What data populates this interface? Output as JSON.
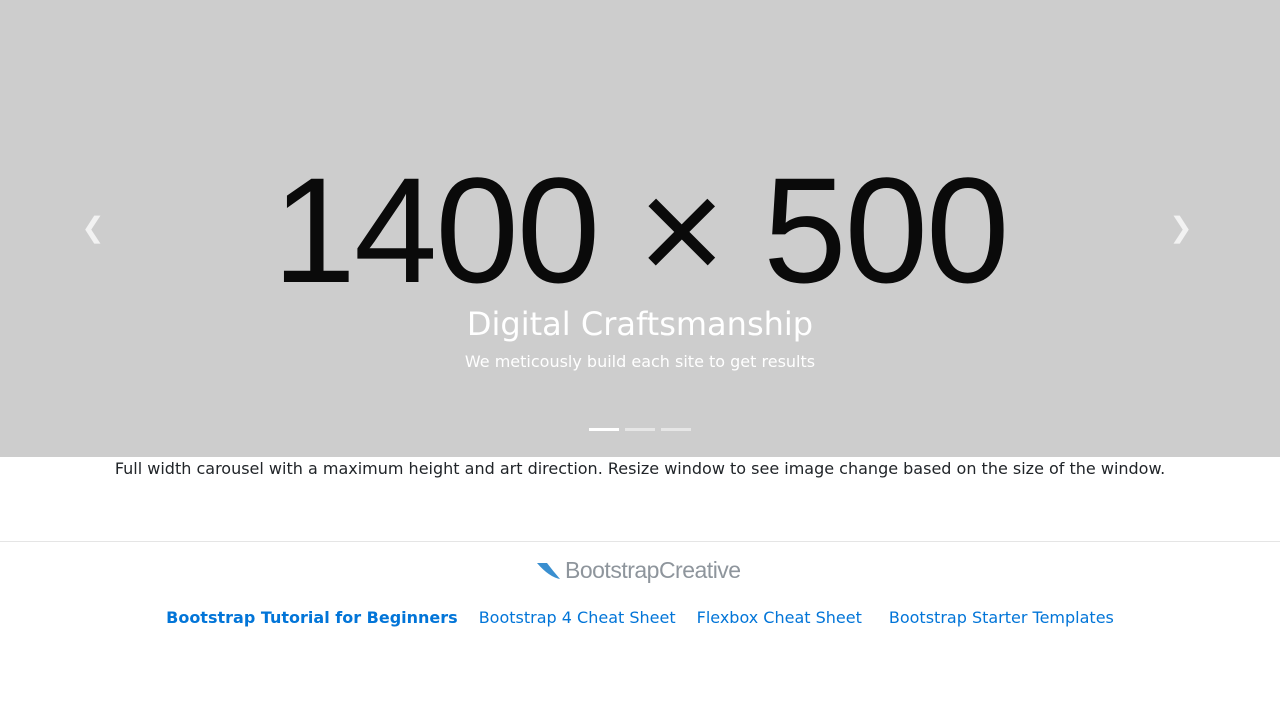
{
  "carousel": {
    "image_text": "1400 × 500",
    "caption_title": "Digital Craftsmanship",
    "caption_text": "We meticously build each site to get results",
    "prev_icon": "chevron-left-icon",
    "next_icon": "chevron-right-icon",
    "indicators": 3,
    "active_index": 0
  },
  "description": "Full width carousel with a maximum height and art direction. Resize window to see image change based on the size of the window.",
  "footer": {
    "logo_text": "BootstrapCreative",
    "links": [
      {
        "label": "Bootstrap Tutorial for Beginners"
      },
      {
        "label": "Bootstrap 4 Cheat Sheet"
      },
      {
        "label": "Flexbox Cheat Sheet"
      },
      {
        "label": "Bootstrap Starter Templates"
      }
    ]
  }
}
